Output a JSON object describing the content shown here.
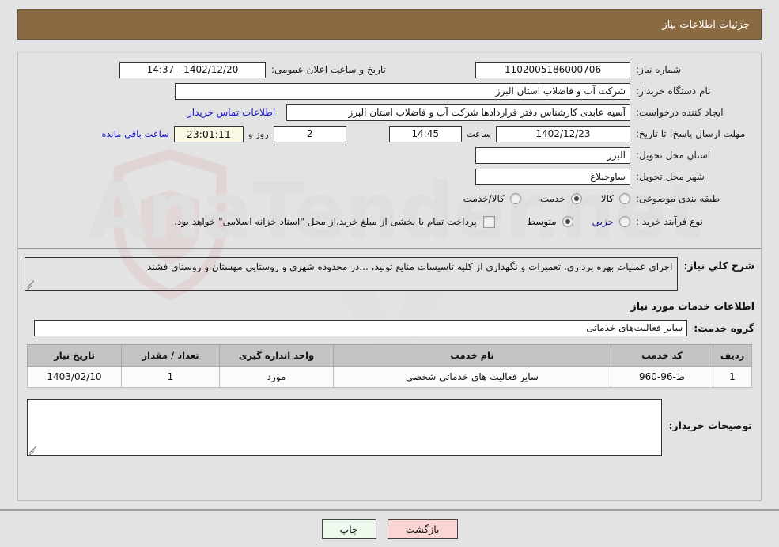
{
  "header": {
    "title": "جزئیات اطلاعات نیاز"
  },
  "top_section": {
    "need_number_label": "شماره نیاز:",
    "need_number_value": "1102005186000706",
    "announce_label": "تاریخ و ساعت اعلان عمومی:",
    "announce_value": "1402/12/20 - 14:37",
    "buyer_org_label": "نام دستگاه خریدار:",
    "buyer_org_value": "شرکت آب و فاضلاب استان البرز",
    "creator_label": "ایجاد کننده درخواست:",
    "creator_value": "آسیه عابدی کارشناس دفتر قراردادها شرکت آب و فاضلاب استان البرز",
    "contact_link": "اطلاعات تماس خریدار",
    "deadline_label": "مهلت ارسال پاسخ: تا تاریخ:",
    "deadline_date": "1402/12/23",
    "hour_label": "ساعت",
    "deadline_time": "14:45",
    "days_remaining": "2",
    "days_label": "روز و",
    "timer_value": "23:01:11",
    "timer_label": "ساعت باقي مانده",
    "province_label": "استان محل تحویل:",
    "province_value": "البرز",
    "city_label": "شهر محل تحویل:",
    "city_value": "ساوجبلاغ",
    "classification_label": "طبقه بندی موضوعی:",
    "classification_options": [
      {
        "label": "کالا",
        "checked": false
      },
      {
        "label": "خدمت",
        "checked": true
      },
      {
        "label": "کالا/خدمت",
        "checked": false
      }
    ],
    "process_label": "نوع فرآیند خرید :",
    "process_options": [
      {
        "label": "جزیي",
        "checked": false
      },
      {
        "label": "متوسط",
        "checked": true
      }
    ],
    "treasury_checkbox_checked": false,
    "treasury_note": "پرداخت تمام یا بخشی از مبلغ خرید،از محل \"اسناد خزانه اسلامی\" خواهد بود."
  },
  "mid_section": {
    "description_label": "شرح کلي نیاز:",
    "description_value": "اجرای عملیات بهره برداری، تعمیرات و نگهداری از کلیه تاسیسات منابع تولید، ...در محدوده شهری و روستایی مهستان و روستای فشند",
    "services_title": "اطلاعات خدمات مورد نیاز",
    "service_group_label": "گروه خدمت:",
    "service_group_value": "سایر فعالیت‌های خدماتی"
  },
  "table": {
    "headers": [
      "ردیف",
      "کد خدمت",
      "نام خدمت",
      "واحد اندازه گیری",
      "تعداد / مقدار",
      "تاریخ نیاز"
    ],
    "rows": [
      {
        "index": "1",
        "code": "ط-96-960",
        "name": "سایر فعالیت های خدماتی شخصی",
        "unit": "مورد",
        "quantity": "1",
        "need_date": "1403/02/10"
      }
    ]
  },
  "notes": {
    "label": "توضیحات خریدار:",
    "value": ""
  },
  "footer": {
    "print_label": "چاپ",
    "back_label": "بازگشت"
  },
  "colors": {
    "header_bg": "#8a6a42",
    "page_bg": "#e3e3e3",
    "link": "#1414d2",
    "timer_bg": "#fbf8e3",
    "print_btn_bg": "#eefaee",
    "back_btn_bg": "#fbd4d4",
    "table_header_bg": "#c4c4c4"
  },
  "watermark": {
    "text": "AnaTender.net"
  }
}
